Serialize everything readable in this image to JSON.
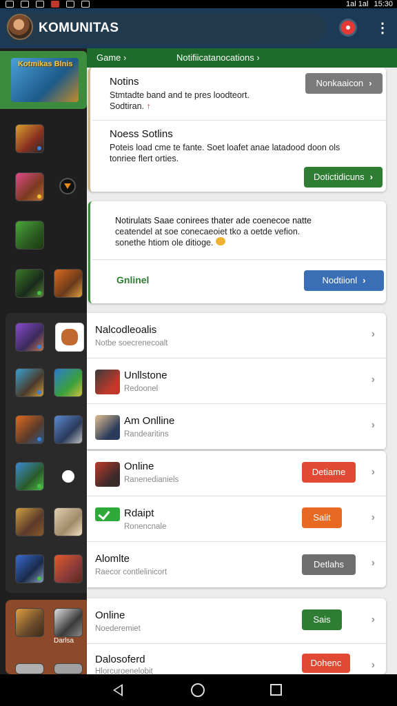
{
  "status_bar": {
    "time": "15:30",
    "icons_right": "1al 1al"
  },
  "app_bar": {
    "title": "KOMUNITAS",
    "avatar_icon": "user-avatar",
    "notification_icon": "alert-icon",
    "more_icon": "more-vert-icon"
  },
  "sidebar": {
    "banner_label": "Kotmikas Blnis",
    "bottom_label": "Darlsa",
    "colors": {
      "banner": "#3d8b3d",
      "bottom": "#8c4a2a"
    }
  },
  "breadcrumb": {
    "item_1": "Game",
    "item_2": "Notifiicatanocations"
  },
  "card1": {
    "section1_title": "Notins",
    "section1_line1": "Stmtadte band and te pres loodteort.",
    "section1_line2": "Sodtiran.",
    "button1_label": "Nonkaaicon",
    "section2_title": "Noess Sotlins",
    "section2_line1": "Poteis load cme te fante. Soet loafet anae latadood doon ols",
    "section2_line2": "tonriee flert orties.",
    "button2_label": "Dotictidicuns"
  },
  "card2": {
    "line1": "Notirulats Saae conirees thater ade coenecoe natte",
    "line2": "ceatendel at soe conecaeoiet tko a oetde vefion.",
    "line3": "sonethe htiom ole ditioge.",
    "status": "Gnlinel",
    "button_label": "Nodtiionl"
  },
  "list1": [
    {
      "title": "Nalcodleoalis",
      "subtitle": "Notbe soecrenecoalt"
    },
    {
      "title": "Unllstone",
      "subtitle": "Redoonel"
    },
    {
      "title": "Am Onlline",
      "subtitle": "Randearitins"
    }
  ],
  "list2": [
    {
      "title": "Online",
      "subtitle": "Ranenedianiels",
      "button": "Detiame"
    },
    {
      "title": "Rdaipt",
      "subtitle": "Ronencnale",
      "button": "Salit"
    },
    {
      "title": "Alomlte",
      "subtitle": "Raecor contlelinicort",
      "button": "Detlahs"
    }
  ],
  "list3": [
    {
      "title": "Online",
      "subtitle": "Noederemiet",
      "button": "Sais"
    },
    {
      "title": "Dalosoferd",
      "subtitle": "Hlorcuroenelobit",
      "button": "Dohenc"
    }
  ],
  "nav": {
    "back_icon": "back-icon",
    "home_icon": "home-icon",
    "recent_icon": "recent-apps-icon"
  },
  "colors": {
    "header": "#1c3a55",
    "breadcrumb": "#1f6b2b",
    "notification": "#e53935"
  }
}
